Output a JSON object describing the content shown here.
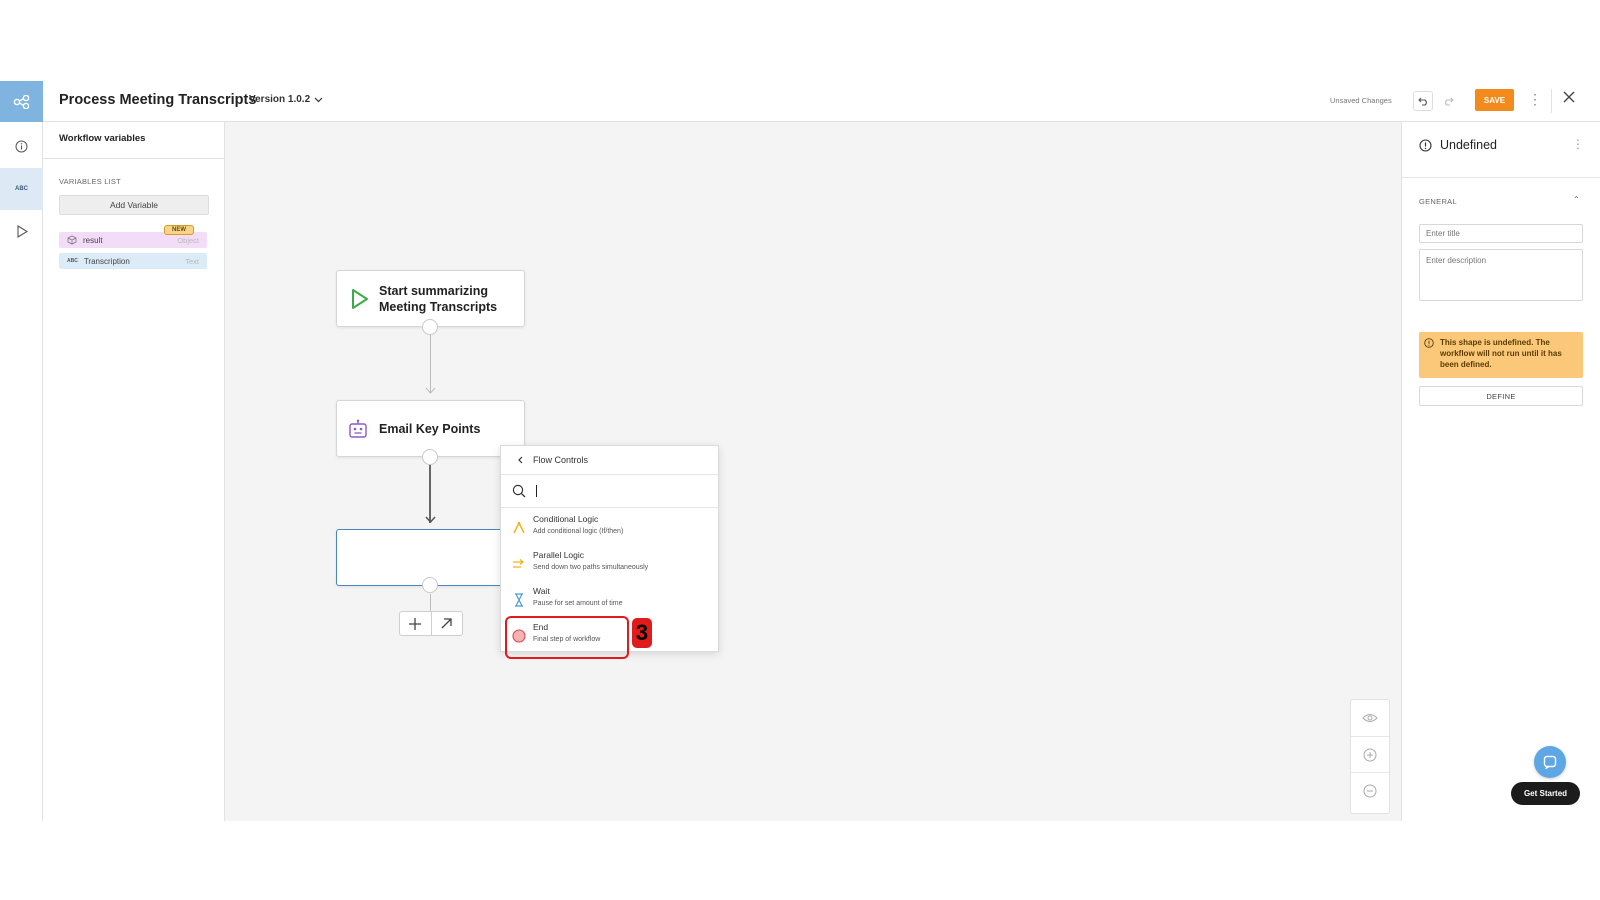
{
  "header": {
    "workflow_title": "Process Meeting Transcripts",
    "version_label": "Version 1.0.2",
    "unsaved_text": "Unsaved Changes",
    "save_label": "SAVE",
    "icons": [
      "share-nodes-icon",
      "undo-icon",
      "redo-icon",
      "more-vertical-icon",
      "close-icon"
    ],
    "accent_color": "#f38a1c"
  },
  "rail": {
    "items": [
      {
        "icon": "info-icon"
      },
      {
        "icon": "abc-variables-icon",
        "label": "ABC"
      },
      {
        "icon": "play-icon"
      }
    ]
  },
  "variables_panel": {
    "title": "Workflow variables",
    "list_label": "VARIABLES LIST",
    "add_button": "Add Variable",
    "new_badge": "NEW",
    "variables": [
      {
        "name": "result",
        "type": "Object",
        "icon": "cube-icon"
      },
      {
        "name": "Transcription",
        "type": "Text",
        "icon": "abc-icon",
        "icon_text": "ABC"
      }
    ]
  },
  "canvas": {
    "nodes": [
      {
        "title_line1": "Start summarizing",
        "title_line2": "Meeting Transcripts",
        "icon": "play-triangle-icon"
      },
      {
        "title": "Email Key Points",
        "icon": "robot-icon"
      }
    ]
  },
  "flow_menu": {
    "back_label": "Flow Controls",
    "search_value": "",
    "items": [
      {
        "title": "Conditional Logic",
        "subtitle": "Add conditional logic (If/then)",
        "icon": "branch-icon"
      },
      {
        "title": "Parallel Logic",
        "subtitle": "Send down two paths simultaneously",
        "icon": "parallel-arrows-icon"
      },
      {
        "title": "Wait",
        "subtitle": "Pause for set amount of time",
        "icon": "hourglass-icon"
      },
      {
        "title": "End",
        "subtitle": "Final step of workflow",
        "icon": "end-circle-icon"
      }
    ],
    "step_badge": "3"
  },
  "right_panel": {
    "title": "Undefined",
    "section_label": "GENERAL",
    "title_placeholder": "Enter title",
    "description_placeholder": "Enter description",
    "warning_text": "This shape is undefined. The workflow will not run until it has been defined.",
    "define_label": "DEFINE"
  },
  "chat": {
    "get_started_label": "Get Started"
  }
}
